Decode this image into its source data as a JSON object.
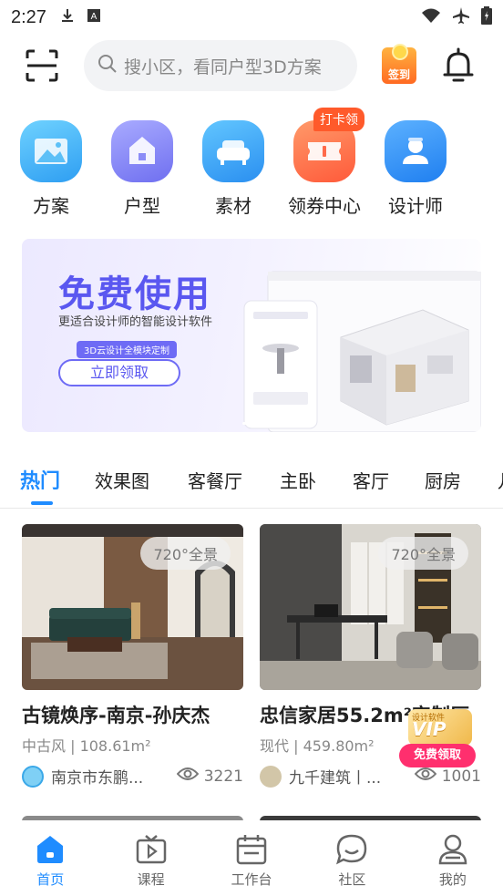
{
  "status_bar": {
    "time": "2:27"
  },
  "header": {
    "search_placeholder": "搜小区，看同户型3D方案",
    "checkin_label": "签到"
  },
  "quick_nav": {
    "items": [
      {
        "label": "方案",
        "icon": "image-icon",
        "color": "#3fb3f5"
      },
      {
        "label": "户型",
        "icon": "house-icon",
        "color": "#8b8cf7"
      },
      {
        "label": "素材",
        "icon": "sofa-icon",
        "color": "#37a6f5"
      },
      {
        "label": "领券中心",
        "icon": "ticket-icon",
        "color": "#ff6a4a"
      },
      {
        "label": "设计师",
        "icon": "designer-icon",
        "color": "#2f8cf5"
      }
    ],
    "coupon_badge": "打卡领"
  },
  "banner": {
    "title": "免费使用",
    "subtitle": "更适合设计师的智能设计软件",
    "tag": "3D云设计全模块定制",
    "button": "立即领取"
  },
  "tabs": [
    {
      "label": "热门",
      "active": true
    },
    {
      "label": "效果图"
    },
    {
      "label": "客餐厅"
    },
    {
      "label": "主卧"
    },
    {
      "label": "客厅"
    },
    {
      "label": "厨房"
    },
    {
      "label": "儿"
    }
  ],
  "cards": [
    {
      "pano": "720°全景",
      "title": "古镜焕序-南京-孙庆杰",
      "meta": "中古风 | 108.61m²",
      "author": "南京市东鹏...",
      "views": "3221"
    },
    {
      "pano": "720°全景",
      "title": "忠信家居55.2m²定制厅",
      "meta": "现代 | 459.80m²",
      "author": "九千建筑丨...",
      "views": "1001"
    }
  ],
  "vip_float": {
    "top": "设计软件",
    "vip": "VIP",
    "button": "免费领取"
  },
  "bottom_nav": [
    {
      "label": "首页",
      "icon": "home-icon",
      "active": true
    },
    {
      "label": "课程",
      "icon": "tv-icon"
    },
    {
      "label": "工作台",
      "icon": "calendar-icon"
    },
    {
      "label": "社区",
      "icon": "chat-icon"
    },
    {
      "label": "我的",
      "icon": "user-icon"
    }
  ],
  "colors": {
    "accent": "#1f8cff",
    "coupon_badge": "#ff5a2b",
    "vip_button": "#ff2f6e"
  }
}
